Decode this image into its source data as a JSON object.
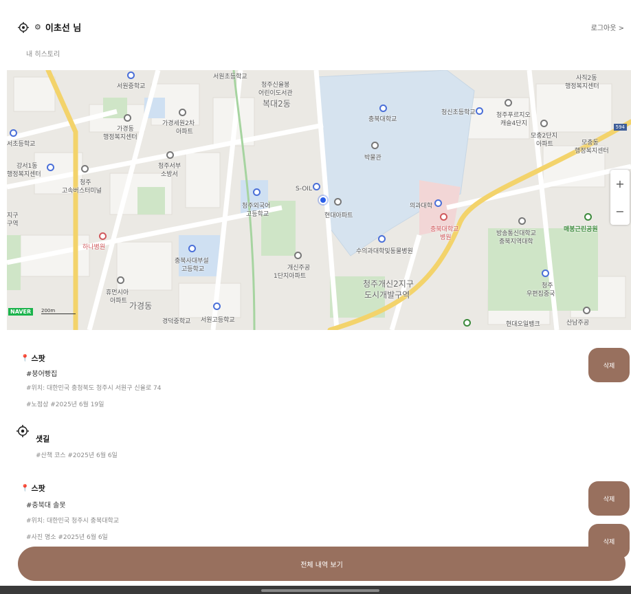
{
  "header": {
    "username": "이초선 님",
    "logout_label": "로그아웃 >",
    "history_label": "내 히스토리"
  },
  "map": {
    "labels": {
      "l1": "서원초등학교",
      "l2": "청주신율봉",
      "l3": "어린이도서관",
      "l4": "복대2동",
      "l5": "사직2동",
      "l6": "행정복지센터",
      "l7": "서원중학교",
      "l8": "가경세원2차",
      "l9": "아파트",
      "l10": "충북대학교",
      "l11": "청신초등학교",
      "l12": "청주푸르지오",
      "l13": "캐슬4단지",
      "l14": "가경동",
      "l15": "행정복지센터",
      "l16": "모충2단지",
      "l17": "아파트",
      "l18": "서초등학교",
      "l19": "박물관",
      "l20": "모충동",
      "l21": "행정복지센터",
      "l22": "강서1동",
      "l23": "행정복지센터",
      "l24": "청주서부",
      "l25": "소방서",
      "l26": "청주",
      "l27": "고속버스터미널",
      "l28": "S-OIL",
      "l29": "의과대학",
      "l30": "청주외국어",
      "l31": "고등학교",
      "l32": "현대아파트",
      "l33": "충북대학교",
      "l34": "병원",
      "l35": "방송통신대학교",
      "l36": "충북지역대학",
      "l37": "매봉근린공원",
      "l38": "하나병원",
      "l39": "수의과대학및동물병원",
      "l40": "충북사대부설",
      "l41": "고등학교",
      "l42": "개신주공",
      "l43": "1단지아파트",
      "l44": "청주개신2지구",
      "l45": "도시개발구역",
      "l46": "청주",
      "l47": "우편집중국",
      "l48": "휴먼시아",
      "l49": "아파트",
      "l50": "가경동",
      "l51": "경덕중학교",
      "l52": "서원고등학교",
      "l53": "현대오일뱅크",
      "l54": "산남주공",
      "l55": "지구",
      "l56": "구역"
    },
    "naver_logo": "NAVER",
    "scale_label": "200m",
    "road_number": "594",
    "zoom_in": "+",
    "zoom_out": "−"
  },
  "items": [
    {
      "type_label": "스팟",
      "name": "#붕어빵집",
      "location": "#위치: 대한민국 충청북도 청주시 서원구 신율로 74",
      "tags": "#노점상  #2025년 6월 19일",
      "delete_label": "삭제"
    },
    {
      "type_label": "샛길",
      "tags": "#산책 코스  #2025년 6월 6일",
      "delete_label": "삭제"
    },
    {
      "type_label": "스팟",
      "name": "#충북대 솔못",
      "location": "#위치: 대한민국 청주시 충북대학교",
      "tags": "#사진 명소  #2025년 6월 6일",
      "delete_label": "삭제"
    }
  ],
  "view_all_label": "전체 내역 보기"
}
